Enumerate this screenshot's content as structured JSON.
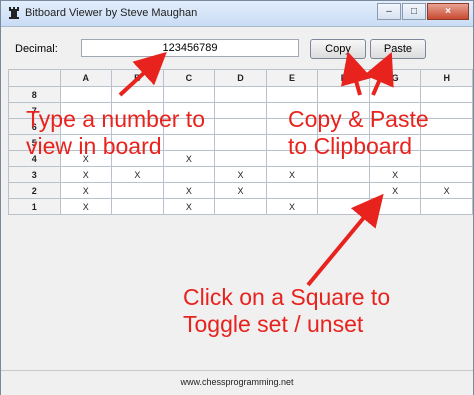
{
  "window": {
    "title": "Bitboard Viewer by Steve Maughan",
    "minimize_glyph": "–",
    "maximize_glyph": "□",
    "close_glyph": "×"
  },
  "decimal": {
    "label": "Decimal:",
    "value": "123456789"
  },
  "buttons": {
    "copy": "Copy",
    "paste": "Paste"
  },
  "board": {
    "columns": [
      "A",
      "B",
      "C",
      "D",
      "E",
      "F",
      "G",
      "H"
    ],
    "rows": [
      {
        "label": "8",
        "cells": [
          "",
          "",
          "",
          "",
          "",
          "",
          "",
          ""
        ]
      },
      {
        "label": "7",
        "cells": [
          "",
          "",
          "",
          "",
          "",
          "",
          "",
          ""
        ]
      },
      {
        "label": "6",
        "cells": [
          "",
          "",
          "",
          "",
          "",
          "",
          "",
          ""
        ]
      },
      {
        "label": "5",
        "cells": [
          "",
          "",
          "",
          "",
          "",
          "",
          "",
          ""
        ]
      },
      {
        "label": "4",
        "cells": [
          "X",
          "",
          "X",
          "",
          "",
          "",
          "",
          ""
        ]
      },
      {
        "label": "3",
        "cells": [
          "X",
          "X",
          "",
          "X",
          "X",
          "",
          "X",
          ""
        ]
      },
      {
        "label": "2",
        "cells": [
          "X",
          "",
          "X",
          "X",
          "",
          "",
          "X",
          "X"
        ]
      },
      {
        "label": "1",
        "cells": [
          "X",
          "",
          "X",
          "",
          "X",
          "",
          "",
          ""
        ]
      }
    ]
  },
  "status_bar": "www.chessprogramming.net",
  "annotations": {
    "type_number": [
      "Type a number to",
      "view in board"
    ],
    "copy_paste": [
      "Copy & Paste",
      "to Clipboard"
    ],
    "click_square": [
      "Click on a Square to",
      "Toggle set / unset"
    ]
  },
  "colors": {
    "annotation": "#e8231e",
    "grid": "#b9c2cc"
  },
  "icons": [
    "chess-rook-icon",
    "minimize-icon",
    "maximize-icon",
    "close-icon",
    "arrow-icon"
  ]
}
